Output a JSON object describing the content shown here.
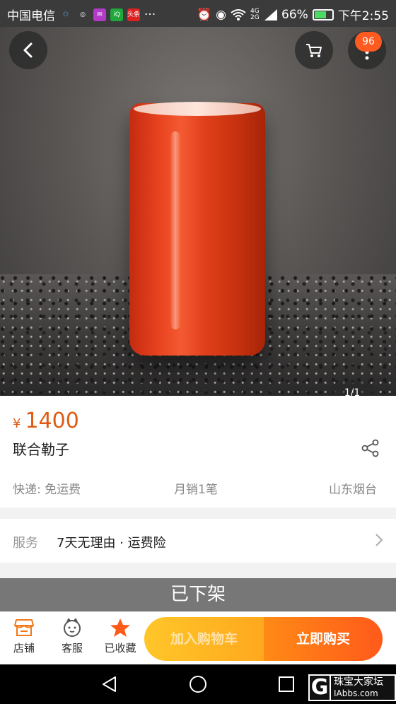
{
  "status_bar": {
    "carrier": "中国电信",
    "apps": [
      {
        "name": "bulb-icon",
        "glyph": "⚇",
        "color": "#3b3b3b"
      },
      {
        "name": "wechat-icon",
        "glyph": "◎",
        "color": "#3b3b3b"
      },
      {
        "name": "app-icon",
        "glyph": "✉",
        "color": "#b23ac7"
      },
      {
        "name": "iqiyi-icon",
        "glyph": "iQ",
        "color": "#1fa83c"
      },
      {
        "name": "toutiao-icon",
        "glyph": "头条",
        "color": "#d22"
      }
    ],
    "more": "···",
    "network": "4G 2G",
    "battery": "66%",
    "battery_level": 0.66,
    "time": "下午2:55"
  },
  "header": {
    "cart_badge": "96"
  },
  "gallery": {
    "pager": "1/1"
  },
  "product": {
    "currency": "¥",
    "price": "1400",
    "title": "联合勒子",
    "shipping": "快递: 免运费",
    "monthly_sales": "月销1笔",
    "location": "山东烟台"
  },
  "service": {
    "label": "服务",
    "value": "7天无理由 · 运费险"
  },
  "status_banner": "已下架",
  "bottom_bar": {
    "store": "店铺",
    "support": "客服",
    "favorited": "已收藏",
    "add_to_cart": "加入购物车",
    "buy_now": "立即购买"
  },
  "watermark": {
    "logo": "G",
    "line1": "珠宝大家坛",
    "line2": "IAbbs.com"
  },
  "colors": {
    "accent": "#e05a12",
    "cart_button": "#ffb41f",
    "buy_button": "#ff6a1a"
  }
}
